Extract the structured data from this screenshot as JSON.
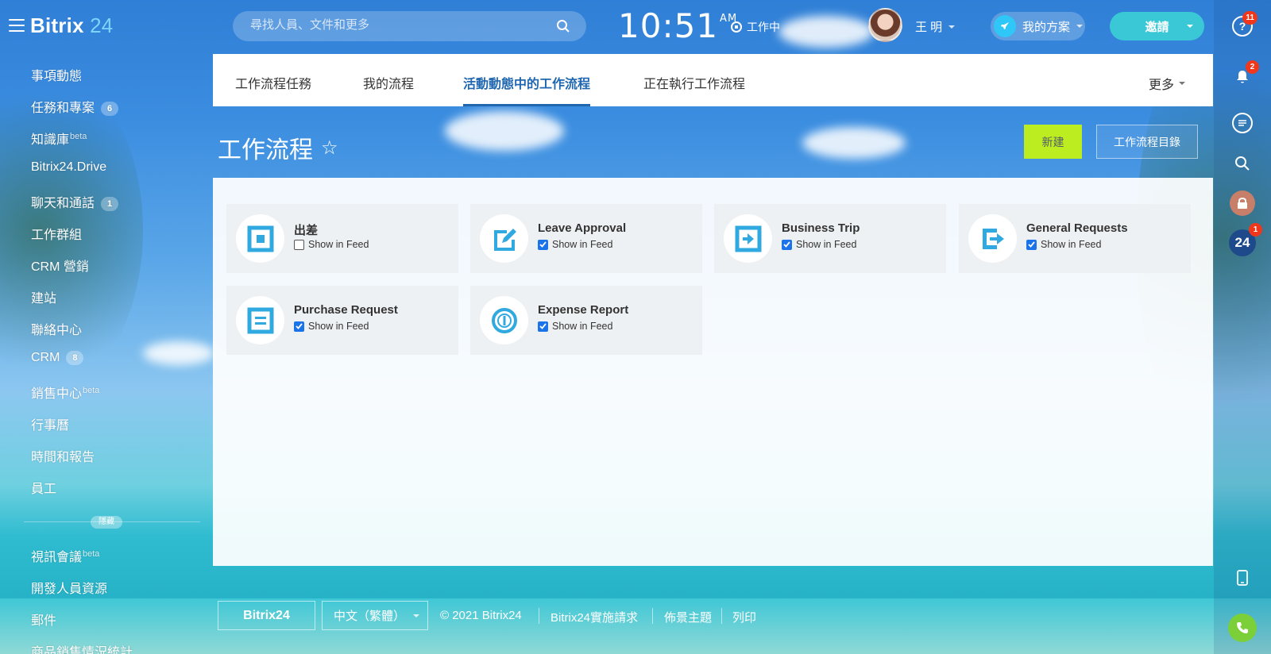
{
  "header": {
    "logo_main": "Bitrix",
    "logo_num": "24",
    "search_placeholder": "尋找人員、文件和更多",
    "clock_time": "10:51",
    "clock_ampm": "AM",
    "status_label": "工作中",
    "user_name": "王 明",
    "plan_label": "我的方案",
    "invite_label": "邀請"
  },
  "rail": {
    "help_badge": "11",
    "bell_badge": "2",
    "b24_label": "24",
    "b24_badge": "1"
  },
  "sidebar": {
    "items": [
      {
        "label": "事項動態"
      },
      {
        "label": "任務和專案",
        "count": "6"
      },
      {
        "label": "知識庫",
        "sup": "beta"
      },
      {
        "label": "Bitrix24.Drive"
      },
      {
        "label": "聊天和通話",
        "count": "1"
      },
      {
        "label": "工作群組"
      },
      {
        "label": "CRM 營銷"
      },
      {
        "label": "建站"
      },
      {
        "label": "聯絡中心"
      },
      {
        "label": "CRM",
        "count": "8"
      },
      {
        "label": "銷售中心",
        "sup": "beta"
      },
      {
        "label": "行事曆"
      },
      {
        "label": "時間和報告"
      },
      {
        "label": "員工"
      },
      {
        "label": "視訊會議",
        "sup": "beta"
      },
      {
        "label": "開發人員資源"
      },
      {
        "label": "郵件"
      },
      {
        "label": "商品銷售情況統計"
      }
    ],
    "hidden_label": "隱藏"
  },
  "tabs": {
    "items": [
      "工作流程任務",
      "我的流程",
      "活動動態中的工作流程",
      "正在執行工作流程"
    ],
    "active_index": 2,
    "more_label": "更多"
  },
  "page": {
    "title": "工作流程",
    "new_button": "新建",
    "catalog_button": "工作流程目錄"
  },
  "workflows": [
    {
      "title": "出差",
      "feed_label": "Show in Feed",
      "checked": false,
      "icon": "square-icon"
    },
    {
      "title": "Leave Approval",
      "feed_label": "Show in Feed",
      "checked": true,
      "icon": "edit-icon"
    },
    {
      "title": "Business Trip",
      "feed_label": "Show in Feed",
      "checked": true,
      "icon": "arrow-right-icon"
    },
    {
      "title": "General Requests",
      "feed_label": "Show in Feed",
      "checked": true,
      "icon": "export-icon"
    },
    {
      "title": "Purchase Request",
      "feed_label": "Show in Feed",
      "checked": true,
      "icon": "list-icon"
    },
    {
      "title": "Expense Report",
      "feed_label": "Show in Feed",
      "checked": true,
      "icon": "coin-icon"
    }
  ],
  "footer": {
    "logo": "Bitrix24",
    "language": "中文（繁體）",
    "copyright": "© 2021 Bitrix24",
    "impl_request": "Bitrix24實施請求",
    "theme": "佈景主題",
    "print": "列印"
  },
  "colors": {
    "accent": "#2067b0",
    "new_button": "#bbed21",
    "invite_button": "#3bc8d6",
    "icon_blue": "#2fa9e0",
    "badge_red": "#f0371b"
  }
}
